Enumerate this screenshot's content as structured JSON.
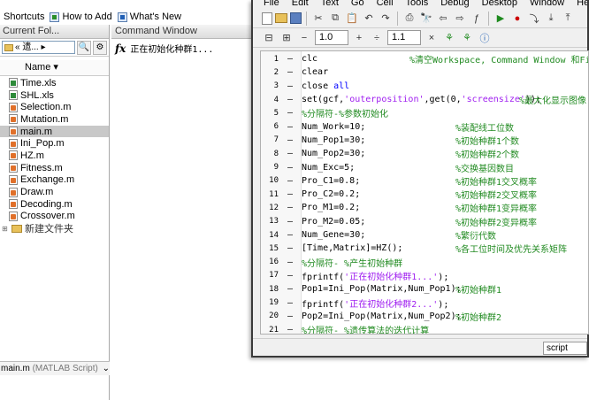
{
  "shortcuts": {
    "shortcuts_label": "Shortcuts",
    "how_to_add_label": "How to Add",
    "whats_new_label": "What's New"
  },
  "current_folder": {
    "title": "Current Fol...",
    "path_text": "« 遗... ▸",
    "column_name": "Name ▾",
    "files": [
      {
        "name": "Time.xls",
        "type": "xls"
      },
      {
        "name": "SHL.xls",
        "type": "xls"
      },
      {
        "name": "Selection.m",
        "type": "m"
      },
      {
        "name": "Mutation.m",
        "type": "m"
      },
      {
        "name": "main.m",
        "type": "m",
        "selected": true
      },
      {
        "name": "Ini_Pop.m",
        "type": "m"
      },
      {
        "name": "HZ.m",
        "type": "m"
      },
      {
        "name": "Fitness.m",
        "type": "m"
      },
      {
        "name": "Exchange.m",
        "type": "m"
      },
      {
        "name": "Draw.m",
        "type": "m"
      },
      {
        "name": "Decoding.m",
        "type": "m"
      },
      {
        "name": "Crossover.m",
        "type": "m"
      }
    ],
    "new_folder_label": "新建文件夹",
    "status_file": "main.m",
    "status_type": "(MATLAB Script)"
  },
  "command_window": {
    "title": "Command Window",
    "output": "正在初始化种群1..."
  },
  "editor": {
    "menu": [
      "File",
      "Edit",
      "Text",
      "Go",
      "Cell",
      "Tools",
      "Debug",
      "Desktop",
      "Window",
      "Help"
    ],
    "cell_value_1": "1.0",
    "cell_value_2": "1.1",
    "status_mode": "script",
    "lines": [
      {
        "n": "1",
        "code": "clc",
        "comment": "%清空Workspace, Command Window 和Figure"
      },
      {
        "n": "2",
        "code": "clear",
        "comment": ""
      },
      {
        "n": "3",
        "code": "close all",
        "comment": ""
      },
      {
        "n": "4",
        "code": "set(gcf,'outerposition',get(0,'screensize'));",
        "comment": "%最大化显示图像"
      },
      {
        "n": "5",
        "code": "%分隔符-%参数初始化",
        "comment": ""
      },
      {
        "n": "6",
        "code": "Num_Work=10;",
        "comment": "%装配线工位数"
      },
      {
        "n": "7",
        "code": "Num_Pop1=30;",
        "comment": "%初始种群1个数"
      },
      {
        "n": "8",
        "code": "Num_Pop2=30;",
        "comment": "%初始种群2个数"
      },
      {
        "n": "9",
        "code": "Num_Exc=5;",
        "comment": "%交换基因数目"
      },
      {
        "n": "10",
        "code": "Pro_C1=0.8;",
        "comment": "%初始种群1交叉概率"
      },
      {
        "n": "11",
        "code": "Pro_C2=0.2;",
        "comment": "%初始种群2交叉概率"
      },
      {
        "n": "12",
        "code": "Pro_M1=0.2;",
        "comment": "%初始种群1变异概率"
      },
      {
        "n": "13",
        "code": "Pro_M2=0.05;",
        "comment": "%初始种群2变异概率"
      },
      {
        "n": "14",
        "code": "Num_Gene=30;",
        "comment": "%繁衍代数"
      },
      {
        "n": "15",
        "code": "[Time,Matrix]=HZ();",
        "comment": "%各工位时间及优先关系矩阵"
      },
      {
        "n": "16",
        "code": "%分隔符- %产生初始种群",
        "comment": ""
      },
      {
        "n": "17",
        "code": "fprintf('正在初始化种群1...');",
        "comment": ""
      },
      {
        "n": "18",
        "code": "Pop1=Ini_Pop(Matrix,Num_Pop1);",
        "comment": "%初始种群1"
      },
      {
        "n": "19",
        "code": "fprintf('正在初始化种群2...');",
        "comment": ""
      },
      {
        "n": "20",
        "code": "Pop2=Ini_Pop(Matrix,Num_Pop2);",
        "comment": "%初始种群2"
      },
      {
        "n": "21",
        "code": "%分隔符- %遗传算法的迭代计算",
        "comment": ""
      }
    ]
  }
}
